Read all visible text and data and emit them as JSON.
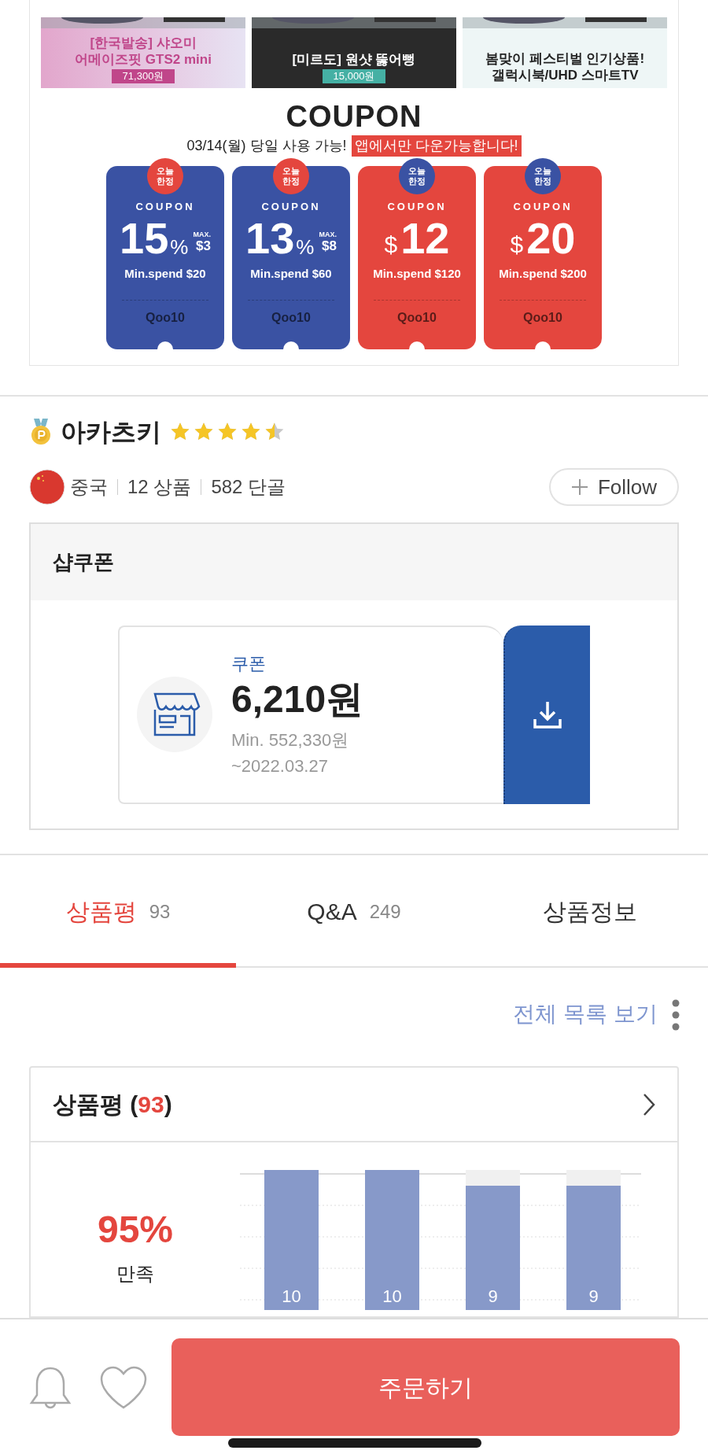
{
  "banners": [
    {
      "kind": "pastel",
      "lines": [
        "[한국발송] 샤오미",
        "어메이즈핏 GTS2 mini"
      ],
      "price": "71,300원",
      "color": "#c0468a"
    },
    {
      "kind": "dark",
      "lines": [
        "[미르도] 원샷 뚫어뻥"
      ],
      "price": "15,000원",
      "color": "#45b0a4"
    },
    {
      "kind": "pale",
      "lines": [
        "봄맞이 페스티벌 인기상품!",
        "갤럭시북/UHD 스마트TV"
      ]
    }
  ],
  "coupon_banner": {
    "title": "COUPON",
    "subtitle": "03/14(월) 당일 사용 가능!",
    "highlight": "앱에서만 다운가능합니다!",
    "coupons": [
      {
        "kind": "percent",
        "color": "#3a52a3",
        "badge": "오늘 한정",
        "label": "COUPON",
        "value": "15",
        "unit": "%",
        "max_label": "MAX.",
        "max": "$3",
        "min_spend": "Min.spend $20",
        "brand": "Qoo10"
      },
      {
        "kind": "percent",
        "color": "#3a52a3",
        "badge": "오늘 한정",
        "label": "COUPON",
        "value": "13",
        "unit": "%",
        "max_label": "MAX.",
        "max": "$8",
        "min_spend": "Min.spend $60",
        "brand": "Qoo10"
      },
      {
        "kind": "amount",
        "color": "#e4463e",
        "badge": "오늘 한정",
        "label": "COUPON",
        "currency": "$",
        "value": "12",
        "min_spend": "Min.spend $120",
        "brand": "Qoo10"
      },
      {
        "kind": "amount",
        "color": "#e4463e",
        "badge": "오늘 한정",
        "label": "COUPON",
        "currency": "$",
        "value": "20",
        "min_spend": "Min.spend $200",
        "brand": "Qoo10"
      }
    ]
  },
  "seller": {
    "name": "아카츠키",
    "stars": 4.5,
    "country": "중국",
    "products": "12 상품",
    "regulars": "582 단골",
    "follow": "Follow"
  },
  "shop_coupon": {
    "title": "샵쿠폰",
    "label": "쿠폰",
    "amount": "6,210원",
    "min": "Min. 552,330원",
    "expiry": "~2022.03.27"
  },
  "tabs": [
    {
      "label": "상품평",
      "count": "93",
      "selected": true
    },
    {
      "label": "Q&A",
      "count": "249",
      "selected": false
    },
    {
      "label": "상품정보",
      "selected": false
    }
  ],
  "list_link": "전체 목록 보기",
  "review": {
    "title": "상품평",
    "paren_open": "(",
    "count": "93",
    "paren_close": ")",
    "satisfaction": "95%",
    "satisfaction_label": "만족",
    "bar_labels": [
      "10",
      "10",
      "9",
      "9"
    ]
  },
  "order_button": "주문하기"
}
